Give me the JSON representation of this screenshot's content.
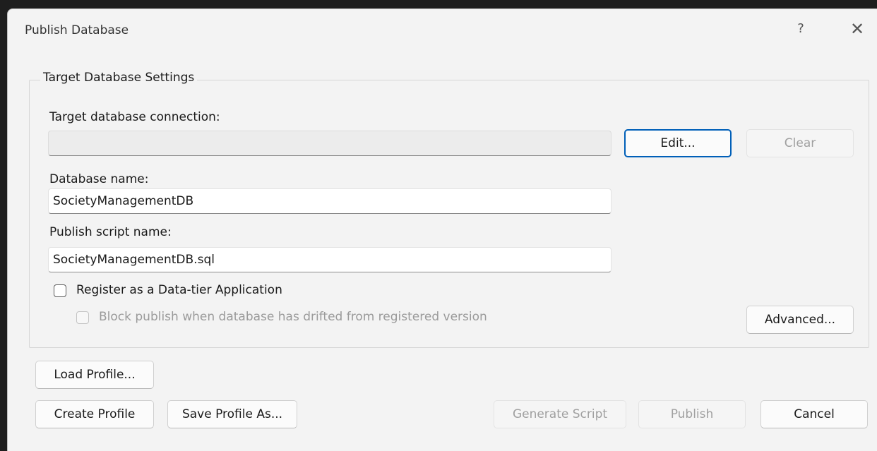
{
  "dialog": {
    "title": "Publish Database",
    "help_glyph": "?",
    "close_glyph": "✕"
  },
  "target_settings": {
    "group_label": "Target Database Settings",
    "connection_label": "Target database connection:",
    "connection_value": "",
    "edit_button": "Edit...",
    "clear_button": "Clear",
    "database_name_label": "Database name:",
    "database_name_value": "SocietyManagementDB",
    "script_name_label": "Publish script name:",
    "script_name_value": "SocietyManagementDB.sql",
    "register_label": "Register as a Data-tier Application",
    "register_checked": false,
    "block_label": "Block publish when database has drifted from registered version",
    "block_checked": false,
    "advanced_button": "Advanced..."
  },
  "profile": {
    "load_button": "Load Profile...",
    "create_button": "Create Profile",
    "save_as_button": "Save Profile As..."
  },
  "actions": {
    "generate_script_button": "Generate Script",
    "publish_button": "Publish",
    "cancel_button": "Cancel"
  }
}
